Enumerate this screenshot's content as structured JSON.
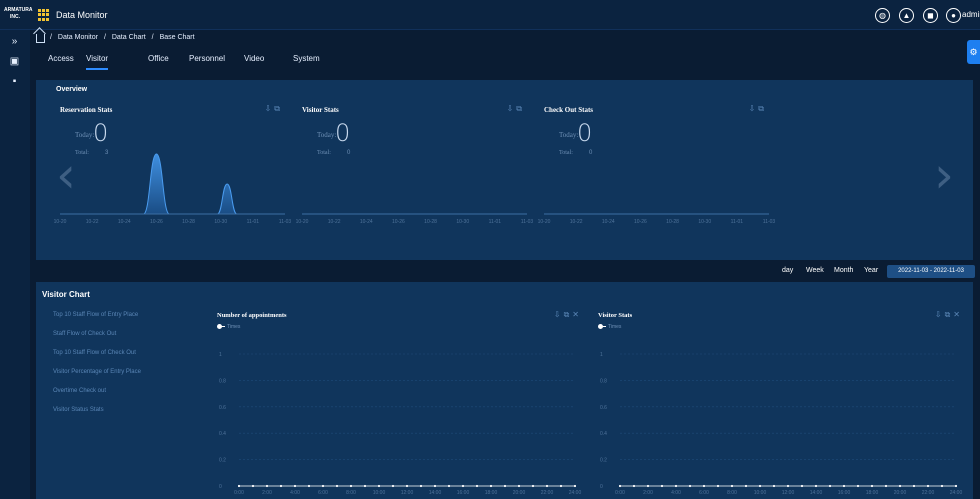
{
  "app": {
    "brand": "ARMATURA INC.",
    "title": "Data Monitor",
    "user": "admin"
  },
  "breadcrumb": [
    "Data Monitor",
    "/",
    "Data Chart",
    "/",
    "Base Chart"
  ],
  "tabs": [
    "Access",
    "Visitor",
    "Office",
    "Personnel",
    "Video",
    "System"
  ],
  "active_tab": "Visitor",
  "overview": {
    "title": "Overview",
    "today_label": "Today:",
    "total_label": "Total:",
    "panels": [
      {
        "title": "Reservation Stats",
        "today": "0",
        "total": "3"
      },
      {
        "title": "Visitor Stats",
        "today": "0",
        "total": "0"
      },
      {
        "title": "Check Out Stats",
        "today": "0",
        "total": "0"
      }
    ]
  },
  "filter": {
    "options": [
      "day",
      "Week",
      "Month",
      "Year"
    ],
    "date_range": "2022-11-03 - 2022-11-03"
  },
  "visitor_chart": {
    "title": "Visitor Chart",
    "items": [
      "Top 10 Staff Flow of Entry Place",
      "Staff Flow of Check Out",
      "Top 10 Staff Flow of Check Out",
      "Visitor Percentage of Entry Place",
      "Overtime Check out",
      "Visitor Status Stats"
    ],
    "panels": [
      {
        "title": "Number of appointments"
      },
      {
        "title": "Visitor Stats"
      }
    ]
  },
  "chart_data": [
    {
      "type": "area",
      "title": "Reservation Stats",
      "x": [
        "10-20",
        "10-22",
        "10-24",
        "10-26",
        "10-28",
        "10-30",
        "11-01",
        "11-03"
      ],
      "series": [
        {
          "points": [
            [
              0,
              0
            ],
            [
              2,
              0
            ],
            [
              2.6,
              0
            ],
            [
              3,
              3
            ],
            [
              3.4,
              0
            ],
            [
              4.9,
              0
            ],
            [
              5.2,
              1.5
            ],
            [
              5.5,
              0
            ],
            [
              7,
              0
            ]
          ]
        }
      ]
    },
    {
      "type": "area",
      "title": "Visitor Stats",
      "x": [
        "10-20",
        "10-22",
        "10-24",
        "10-26",
        "10-28",
        "10-30",
        "11-01",
        "11-03"
      ],
      "series": [
        {
          "values": [
            0,
            0,
            0,
            0,
            0,
            0,
            0,
            0
          ]
        }
      ]
    },
    {
      "type": "area",
      "title": "Check Out Stats",
      "x": [
        "10-20",
        "10-22",
        "10-24",
        "10-26",
        "10-28",
        "10-30",
        "11-01",
        "11-03"
      ],
      "series": [
        {
          "values": [
            0,
            0,
            0,
            0,
            0,
            0,
            0,
            0
          ]
        }
      ]
    },
    {
      "type": "line",
      "title": "Number of appointments",
      "x": [
        "0:00",
        "2:00",
        "4:00",
        "6:00",
        "8:00",
        "10:00",
        "12:00",
        "14:00",
        "16:00",
        "18:00",
        "20:00",
        "22:00",
        "24:00"
      ],
      "yticks": [
        "0",
        "0.2",
        "0.4",
        "0.6",
        "0.8",
        "1"
      ],
      "ylim": [
        0,
        1
      ],
      "series": [
        {
          "name": "Times",
          "values": [
            0,
            0,
            0,
            0,
            0,
            0,
            0,
            0,
            0,
            0,
            0,
            0,
            0,
            0,
            0,
            0,
            0,
            0,
            0,
            0,
            0,
            0,
            0,
            0,
            0
          ]
        }
      ]
    },
    {
      "type": "line",
      "title": "Visitor Stats",
      "x": [
        "0:00",
        "2:00",
        "4:00",
        "6:00",
        "8:00",
        "10:00",
        "12:00",
        "14:00",
        "16:00",
        "18:00",
        "20:00",
        "22:00",
        "24:00"
      ],
      "yticks": [
        "0",
        "0.2",
        "0.4",
        "0.6",
        "0.8",
        "1"
      ],
      "ylim": [
        0,
        1
      ],
      "series": [
        {
          "name": "Times",
          "values": [
            0,
            0,
            0,
            0,
            0,
            0,
            0,
            0,
            0,
            0,
            0,
            0,
            0,
            0,
            0,
            0,
            0,
            0,
            0,
            0,
            0,
            0,
            0,
            0,
            0
          ]
        }
      ]
    }
  ]
}
